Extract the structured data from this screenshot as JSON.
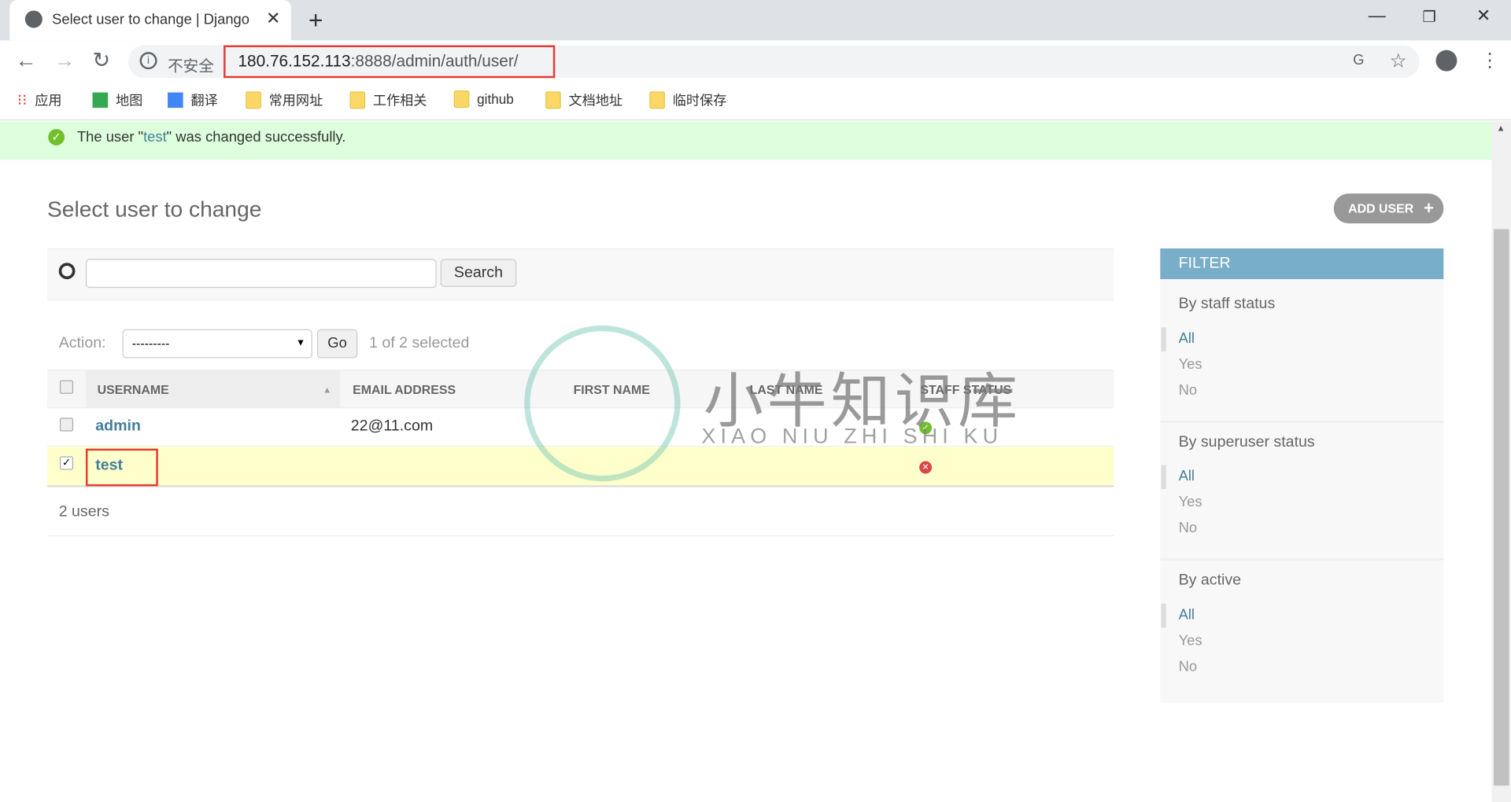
{
  "browser": {
    "tab_title": "Select user to change | Django",
    "security_label": "不安全",
    "url_host": "180.76.152.113",
    "url_rest": ":8888/admin/auth/user/",
    "bookmarks": [
      "应用",
      "地图",
      "翻译",
      "常用网址",
      "工作相关",
      "github",
      "文档地址",
      "临时保存"
    ]
  },
  "message": {
    "prefix": "The user \"",
    "user": "test",
    "suffix": "\" was changed successfully.",
    "color": "#dfd"
  },
  "page": {
    "title": "Select user to change",
    "add_user_label": "ADD USER",
    "search_button": "Search",
    "search_value": "",
    "action_label": "Action:",
    "action_value": "---------",
    "go_label": "Go",
    "selected_text": "1 of 2 selected",
    "columns": [
      "USERNAME",
      "EMAIL ADDRESS",
      "FIRST NAME",
      "LAST NAME",
      "STAFF STATUS"
    ],
    "rows": [
      {
        "username": "admin",
        "email": "22@11.com",
        "first": "",
        "last": "",
        "staff": true,
        "checked": false
      },
      {
        "username": "test",
        "email": "",
        "first": "",
        "last": "",
        "staff": false,
        "checked": true
      }
    ],
    "count_text": "2 users"
  },
  "filter": {
    "title": "FILTER",
    "header_color": "#79aec8",
    "groups": [
      {
        "title": "By staff status",
        "options": [
          "All",
          "Yes",
          "No"
        ],
        "selected": "All"
      },
      {
        "title": "By superuser status",
        "options": [
          "All",
          "Yes",
          "No"
        ],
        "selected": "All"
      },
      {
        "title": "By active",
        "options": [
          "All",
          "Yes",
          "No"
        ],
        "selected": "All"
      }
    ]
  },
  "watermark": {
    "text": "小牛知识库",
    "sub": "XIAO NIU ZHI SHI KU"
  }
}
